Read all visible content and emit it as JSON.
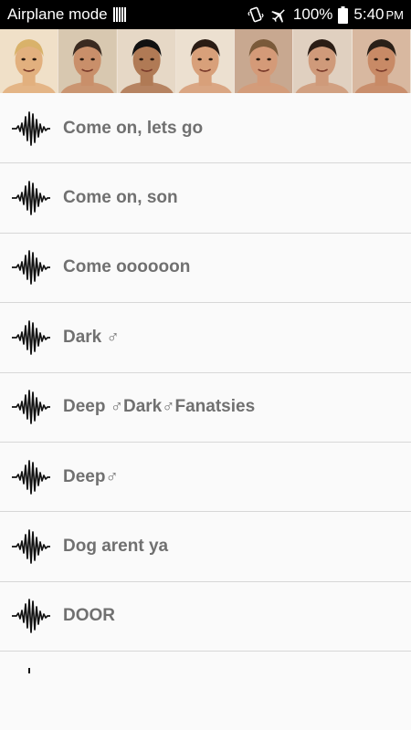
{
  "status_bar": {
    "mode_label": "Airplane mode",
    "battery_percent": "100%",
    "time": "5:40",
    "ampm": "PM",
    "icons": [
      "barcode-icon",
      "vibrate-icon",
      "airplane-icon",
      "battery-icon"
    ]
  },
  "banner": {
    "faces": [
      {
        "skin": "#e2b07e",
        "hair": "#d9b26a",
        "bg": "#f0e0c8"
      },
      {
        "skin": "#c98f6a",
        "hair": "#3a2a20",
        "bg": "#d8c8b0"
      },
      {
        "skin": "#b07a55",
        "hair": "#111111",
        "bg": "#e6d8c6"
      },
      {
        "skin": "#d8a07a",
        "hair": "#2a1c14",
        "bg": "#ece0d0"
      },
      {
        "skin": "#d49a78",
        "hair": "#7a5a3a",
        "bg": "#c8a890"
      },
      {
        "skin": "#cf9a7a",
        "hair": "#2b1d15",
        "bg": "#e0d0c0"
      },
      {
        "skin": "#c88a66",
        "hair": "#2a2018",
        "bg": "#d8b8a0"
      }
    ]
  },
  "sounds": [
    {
      "label": "Come on, lets go"
    },
    {
      "label": "Come on, son"
    },
    {
      "label": "Come oooooon"
    },
    {
      "label": "Dark ♂"
    },
    {
      "label": "Deep  ♂Dark♂Fanatsies"
    },
    {
      "label": "Deep♂"
    },
    {
      "label": "Dog arent ya"
    },
    {
      "label": "DOOR"
    }
  ],
  "item_icon": "waveform-icon"
}
